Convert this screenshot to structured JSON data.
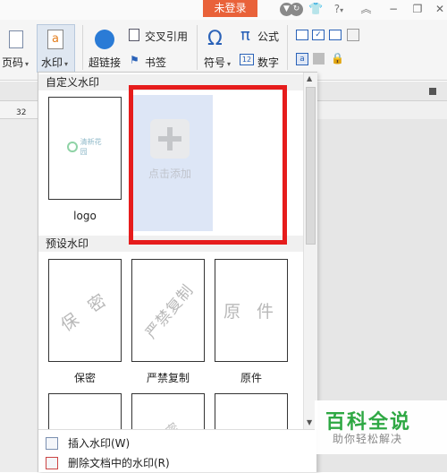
{
  "titlebar": {
    "login_label": "未登录",
    "icons": [
      "shield-icon",
      "refresh-icon",
      "shirt-icon",
      "help-icon",
      "collapse-icon"
    ],
    "help_label": "?",
    "window_buttons": [
      "−",
      "❐",
      "✕"
    ]
  },
  "ribbon": {
    "page_number_label": "页码",
    "watermark_label": "水印",
    "hyperlink_label": "超链接",
    "cross_ref_label": "交叉引用",
    "bookmark_label": "书签",
    "symbol_label": "符号",
    "formula_label": "公式",
    "number_label": "数字",
    "formula_glyph": "π",
    "symbol_glyph": "Ω"
  },
  "ruler": {
    "number": "32"
  },
  "panel": {
    "custom_header": "自定义水印",
    "custom_items": [
      {
        "label": "logo",
        "preview_text": "清新花园"
      }
    ],
    "add_label": "点击添加",
    "preset_header": "预设水印",
    "preset_items": [
      {
        "label": "保密",
        "watermark": "保 密"
      },
      {
        "label": "严禁复制",
        "watermark": "严禁复制"
      },
      {
        "label": "原件",
        "watermark": "原 件"
      }
    ],
    "preset_row2_watermark": "密",
    "menu": [
      {
        "label": "插入水印(W)"
      },
      {
        "label": "删除文档中的水印(R)"
      }
    ]
  },
  "badge": {
    "title": "百科全说",
    "subtitle": "助你轻松解决"
  },
  "colors": {
    "login_bg": "#e9623a",
    "highlight": "#e61c1c",
    "badge_green": "#2ea843",
    "add_tile_bg": "#dde6f6"
  }
}
